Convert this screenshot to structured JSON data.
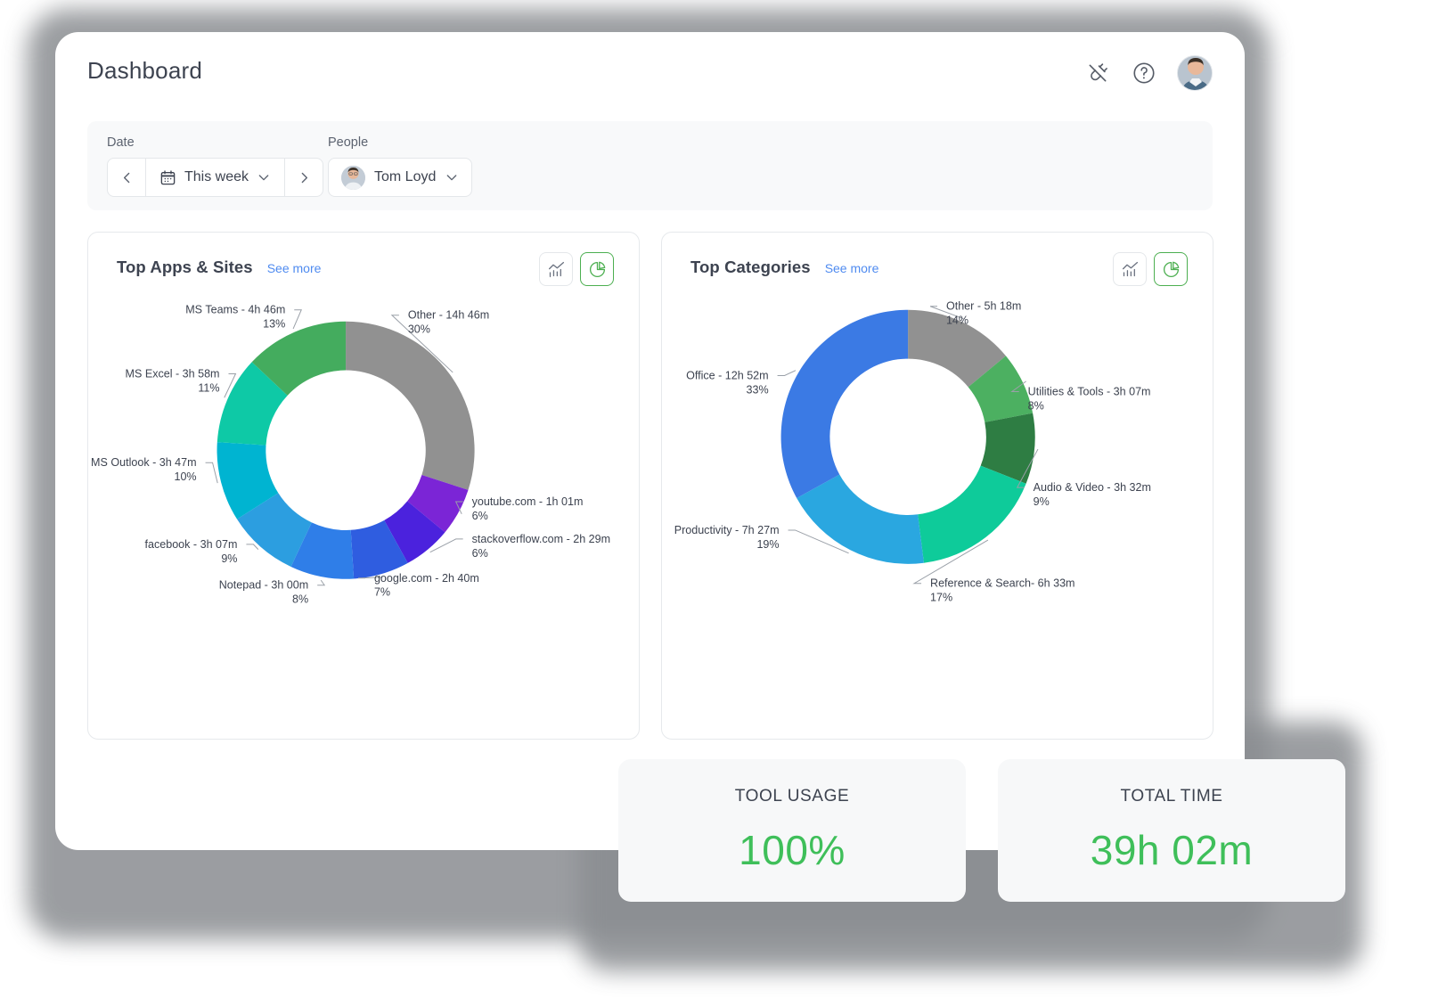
{
  "header": {
    "title": "Dashboard",
    "actions": [
      {
        "name": "plug-disconnected-icon",
        "label": "Disconnected"
      },
      {
        "name": "help-icon",
        "label": "Help"
      },
      {
        "name": "avatar",
        "label": "Account"
      }
    ]
  },
  "filters": {
    "date": {
      "label": "Date",
      "value": "This week",
      "prev_label": "Previous period",
      "next_label": "Next period"
    },
    "people": {
      "label": "People",
      "value": "Tom Loyd"
    }
  },
  "cards": [
    {
      "title": "Top Apps & Sites",
      "see_more": "See more",
      "view_line_label": "Line chart view",
      "view_pie_label": "Pie chart view",
      "active_view": "pie"
    },
    {
      "title": "Top Categories",
      "see_more": "See more",
      "view_line_label": "Line chart view",
      "view_pie_label": "Pie chart view",
      "active_view": "pie"
    }
  ],
  "stats": [
    {
      "label": "TOOL USAGE",
      "value": "100%"
    },
    {
      "label": "TOTAL TIME",
      "value": "39h 02m"
    }
  ],
  "colors": {
    "accent_green": "#3fbf5a",
    "link_blue": "#4f8bf0",
    "text": "#3d4350",
    "panel": "#f8f9fa"
  },
  "chart_data": [
    {
      "type": "pie",
      "title": "Top Apps & Sites",
      "legend": "labels",
      "labels": [
        "Other",
        "youtube.com",
        "stackoverflow.com",
        "google.com",
        "Notepad",
        "facebook",
        "MS Outlook",
        "MS Excel",
        "MS Teams"
      ],
      "values": [
        30,
        6,
        6,
        7,
        8,
        9,
        10,
        11,
        13
      ],
      "durations": [
        "14h 46m",
        "1h 01m",
        "2h 29m",
        "2h 40m",
        "3h 00m",
        "3h 07m",
        "3h 47m",
        "3h 58m",
        "4h 46m"
      ],
      "percent_labels": [
        "30%",
        "6%",
        "6%",
        "7%",
        "8%",
        "9%",
        "10%",
        "11%",
        "13%"
      ],
      "colors": [
        "#919191",
        "#7b25d6",
        "#4b22dd",
        "#2f5de0",
        "#2f7ee8",
        "#2c9ee0",
        "#00b4d1",
        "#0ec9a6",
        "#44ac5e"
      ],
      "label_texts": [
        "Other - 14h 46m",
        "youtube.com - 1h 01m",
        "stackoverflow.com - 2h 29m",
        "google.com - 2h 40m",
        "Notepad - 3h 00m",
        "facebook - 3h 07m",
        "MS Outlook - 3h 47m",
        "MS Excel - 3h 58m",
        "MS Teams - 4h 46m"
      ]
    },
    {
      "type": "pie",
      "title": "Top Categories",
      "legend": "labels",
      "labels": [
        "Other",
        "Utilities & Tools",
        "Audio & Video",
        "Reference & Search",
        "Productivity",
        "Office"
      ],
      "values": [
        14,
        8,
        9,
        17,
        19,
        33
      ],
      "durations": [
        "5h 18m",
        "3h 07m",
        "3h 32m",
        "6h 33m",
        "7h 27m",
        "12h 52m"
      ],
      "percent_labels": [
        "14%",
        "8%",
        "9%",
        "17%",
        "19%",
        "33%"
      ],
      "colors": [
        "#919191",
        "#4cb061",
        "#2e7d43",
        "#0ecb9a",
        "#2aa7e0",
        "#3b7ae4"
      ],
      "label_texts": [
        "Other - 5h 18m",
        "Utilities & Tools - 3h 07m",
        "Audio & Video - 3h 32m",
        "Reference & Search- 6h 33m",
        "Productivity - 7h 27m",
        "Office - 12h 52m"
      ]
    }
  ]
}
